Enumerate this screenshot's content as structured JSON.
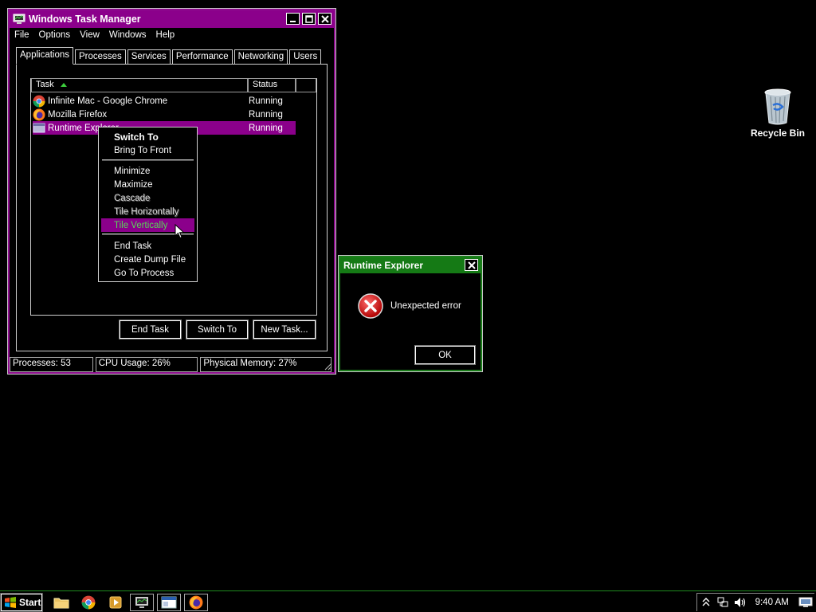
{
  "task_manager": {
    "title": "Windows Task Manager",
    "menu": [
      "File",
      "Options",
      "View",
      "Windows",
      "Help"
    ],
    "tabs": [
      "Applications",
      "Processes",
      "Services",
      "Performance",
      "Networking",
      "Users"
    ],
    "active_tab": "Applications",
    "columns": {
      "task": "Task",
      "status": "Status"
    },
    "rows": [
      {
        "name": "Infinite Mac - Google Chrome",
        "status": "Running",
        "icon": "chrome-icon"
      },
      {
        "name": "Mozilla Firefox",
        "status": "Running",
        "icon": "firefox-icon"
      },
      {
        "name": "Runtime Explorer",
        "status": "Running",
        "icon": "window-icon",
        "selected": true
      }
    ],
    "buttons": {
      "end_task": "End Task",
      "switch_to": "Switch To",
      "new_task": "New Task..."
    },
    "status": {
      "processes": "Processes: 53",
      "cpu": "CPU Usage: 26%",
      "memory": "Physical Memory: 27%"
    }
  },
  "context_menu": {
    "items": [
      "Switch To",
      "Bring To Front",
      "Minimize",
      "Maximize",
      "Cascade",
      "Tile Horizontally",
      "Tile Vertically",
      "End Task",
      "Create Dump File",
      "Go To Process"
    ],
    "highlighted": "Tile Vertically"
  },
  "error_dialog": {
    "title": "Runtime Explorer",
    "message": "Unexpected error",
    "ok": "OK"
  },
  "desktop": {
    "recycle_bin": "Recycle Bin"
  },
  "taskbar": {
    "start": "Start",
    "clock": "9:40 AM",
    "apps": [
      "folder-icon",
      "chrome-icon",
      "media-player-icon",
      "task-manager-icon",
      "window-icon",
      "firefox-icon"
    ]
  },
  "colors": {
    "purple": "#8b008b",
    "green": "#157a15",
    "menu_highlight_text": "#58d858"
  }
}
